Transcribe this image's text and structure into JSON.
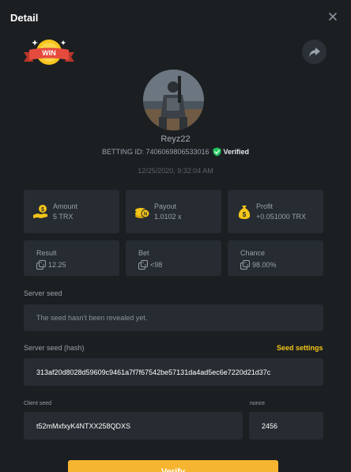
{
  "header": {
    "title": "Detail"
  },
  "badge": {
    "text": "WIN"
  },
  "user": {
    "name": "Reyz22",
    "betting_id_label": "BETTING ID: 7406069806533016",
    "verified_label": "Verified",
    "timestamp": "12/25/2020, 9:32:04 AM"
  },
  "stats": {
    "amount": {
      "label": "Amount",
      "value": "5 TRX"
    },
    "payout": {
      "label": "Payout",
      "value": "1.0102 x"
    },
    "profit": {
      "label": "Profit",
      "value": "+0.051000 TRX"
    },
    "result": {
      "label": "Result",
      "value": "12.25"
    },
    "bet": {
      "label": "Bet",
      "value": "<98"
    },
    "chance": {
      "label": "Chance",
      "value": "98.00%"
    }
  },
  "server_seed": {
    "label": "Server seed",
    "value": "The seed hasn't been revealed yet."
  },
  "server_seed_hash": {
    "label": "Server seed (hash)",
    "settings_label": "Seed settings",
    "value": "313af20d8028d59609c9461a7f7f67542be57131da4ad5ec6e7220d21d37c"
  },
  "client_seed": {
    "label": "Client seed",
    "value": "t52mMxfxyK4NTXX258QDXS"
  },
  "nonce": {
    "label": "nonce",
    "value": "2456"
  },
  "verify_button": {
    "label": "Verify"
  },
  "colors": {
    "background": "#1b1f22",
    "card": "#262c31",
    "accent_yellow": "#f5c518",
    "verified_green": "#22c55e",
    "badge_red": "#e54b3c"
  }
}
